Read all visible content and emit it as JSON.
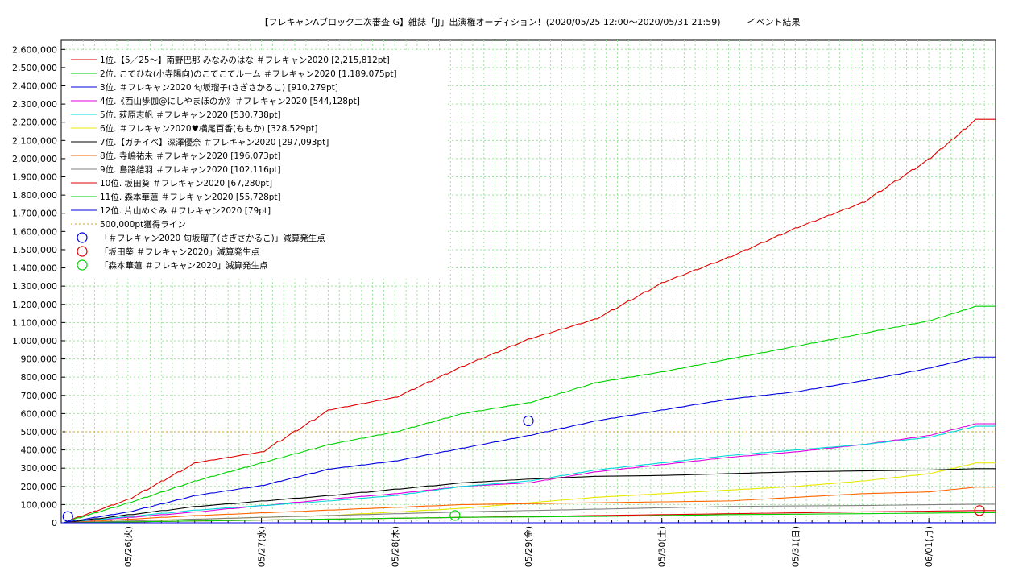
{
  "chart_data": {
    "type": "line",
    "title": "【フレキャンAブロック二次審査 G】雑誌「JJ」出演権オーディション！(2020/05/25 12:00〜2020/05/31 21:59)　　　イベント結果",
    "ylim": [
      0,
      2650000
    ],
    "y_ticks": [
      "0",
      "100,000",
      "200,000",
      "300,000",
      "400,000",
      "500,000",
      "600,000",
      "700,000",
      "800,000",
      "900,000",
      "1,000,000",
      "1,100,000",
      "1,200,000",
      "1,300,000",
      "1,400,000",
      "1,500,000",
      "1,600,000",
      "1,700,000",
      "1,800,000",
      "1,900,000",
      "2,000,000",
      "2,100,000",
      "2,200,000",
      "2,300,000",
      "2,400,000",
      "2,500,000",
      "2,600,000"
    ],
    "xlim": [
      "05/25 12:00",
      "06/01 12:00"
    ],
    "x_ticks": [
      "05/26(火)",
      "05/27(水)",
      "05/28(木)",
      "05/29(金)",
      "05/30(土)",
      "05/31(日)",
      "06/01(月)"
    ],
    "grid": true,
    "legend_position": "top-left",
    "reference_line": {
      "label": "500,000pt獲得ライン",
      "value": 500000,
      "color": "#d4a017"
    },
    "series": [
      {
        "name": "1位.【5／25〜】南野巴那 みなみのはな ＃フレキャン2020 [2,215,812pt]",
        "color": "#e00000",
        "x": [
          0,
          0.5,
          1,
          1.5,
          2,
          2.5,
          3,
          3.5,
          4,
          4.5,
          5,
          5.5,
          6,
          6.5,
          6.85
        ],
        "y": [
          0,
          130000,
          330000,
          390000,
          620000,
          690000,
          860000,
          1010000,
          1120000,
          1320000,
          1460000,
          1620000,
          1760000,
          2000000,
          2215812
        ]
      },
      {
        "name": "2位. こてひな(小寺陽向)のこてこてルーム ＃フレキャン2020 [1,189,075pt]",
        "color": "#00d000",
        "x": [
          0,
          0.5,
          1,
          1.5,
          2,
          2.5,
          3,
          3.5,
          4,
          4.5,
          5,
          5.5,
          6,
          6.5,
          6.85
        ],
        "y": [
          0,
          110000,
          230000,
          330000,
          430000,
          500000,
          600000,
          660000,
          770000,
          830000,
          900000,
          970000,
          1040000,
          1110000,
          1189075
        ]
      },
      {
        "name": "3位. ＃フレキャン2020 匂坂瑠子(さぎさかるこ) [910,279pt]",
        "color": "#0000e0",
        "x": [
          0,
          0.5,
          1,
          1.5,
          2,
          2.5,
          3,
          3.5,
          4,
          4.5,
          5,
          5.5,
          6,
          6.5,
          6.85
        ],
        "y": [
          0,
          60000,
          150000,
          205000,
          295000,
          340000,
          410000,
          480000,
          560000,
          620000,
          680000,
          720000,
          780000,
          850000,
          910279
        ]
      },
      {
        "name": "4位.《西山歩伽@にしやまほのか》＃フレキャン2020 [544,128pt]",
        "color": "#e000e0",
        "x": [
          0,
          1,
          2,
          2.5,
          3,
          3.5,
          4,
          4.5,
          5,
          5.5,
          6,
          6.5,
          6.85
        ],
        "y": [
          0,
          60000,
          130000,
          160000,
          200000,
          220000,
          280000,
          320000,
          360000,
          390000,
          430000,
          480000,
          544128
        ]
      },
      {
        "name": "5位. 荻原志帆 ＃フレキャン2020 [530,738pt]",
        "color": "#00d8d8",
        "x": [
          0,
          1,
          2,
          2.5,
          3,
          3.5,
          4,
          4.5,
          5,
          5.5,
          6,
          6.5,
          6.85
        ],
        "y": [
          0,
          70000,
          120000,
          150000,
          200000,
          230000,
          290000,
          330000,
          370000,
          400000,
          430000,
          470000,
          530738
        ]
      },
      {
        "name": "6位. ＃フレキャン2020♥横尾百香(ももか) [328,529pt]",
        "color": "#e8e800",
        "x": [
          0,
          1,
          2,
          3,
          3.5,
          4,
          4.5,
          5,
          5.5,
          6,
          6.5,
          6.85
        ],
        "y": [
          0,
          20000,
          40000,
          80000,
          110000,
          140000,
          160000,
          180000,
          200000,
          230000,
          270000,
          328529
        ]
      },
      {
        "name": "7位.【ガチイベ】深澤優奈 ＃フレキャン2020 [297,093pt]",
        "color": "#000000",
        "x": [
          0,
          1,
          2,
          3,
          3.5,
          4,
          4.5,
          5,
          5.5,
          6,
          6.5,
          6.85
        ],
        "y": [
          0,
          90000,
          150000,
          220000,
          240000,
          255000,
          260000,
          270000,
          280000,
          285000,
          290000,
          297093
        ]
      },
      {
        "name": "8位. 寺嶋祐未 ＃フレキャン2020 [196,073pt]",
        "color": "#ff6600",
        "x": [
          0,
          1,
          2,
          3,
          4,
          5,
          5.5,
          6,
          6.5,
          6.85
        ],
        "y": [
          0,
          40000,
          70000,
          100000,
          110000,
          120000,
          140000,
          160000,
          170000,
          196073
        ]
      },
      {
        "name": "9位. 島路結羽 ＃フレキャン2020 [102,116pt]",
        "color": "#808080",
        "x": [
          0,
          1,
          2,
          3,
          4,
          5,
          6,
          6.85
        ],
        "y": [
          0,
          20000,
          40000,
          60000,
          75000,
          90000,
          95000,
          102116
        ]
      },
      {
        "name": "10位. 坂田葵 ＃フレキャン2020 [67,280pt]",
        "color": "#e00000",
        "x": [
          0,
          1,
          2,
          3,
          4,
          5,
          6,
          6.85
        ],
        "y": [
          0,
          10000,
          20000,
          30000,
          40000,
          50000,
          60000,
          67280
        ]
      },
      {
        "name": "11位. 森本華蓮 ＃フレキャン2020 [55,728pt]",
        "color": "#00d000",
        "x": [
          0,
          1,
          2,
          3,
          4,
          5,
          6,
          6.85
        ],
        "y": [
          0,
          10000,
          20000,
          30000,
          35000,
          45000,
          50000,
          55728
        ]
      },
      {
        "name": "12位. 片山めぐみ ＃フレキャン2020 [79pt]",
        "color": "#0000e0",
        "x": [
          0,
          6.85
        ],
        "y": [
          0,
          79
        ]
      }
    ],
    "markers": [
      {
        "name": "「＃フレキャン2020 匂坂瑠子(さぎさかるこ)」減算発生点",
        "color": "#0000e0",
        "points": [
          [
            0.05,
            35000
          ],
          [
            3.5,
            560000
          ]
        ]
      },
      {
        "name": "「坂田葵 ＃フレキャン2020」減算発生点",
        "color": "#e00000",
        "points": [
          [
            6.88,
            67280
          ]
        ]
      },
      {
        "name": "「森本華蓮 ＃フレキャン2020」減算発生点",
        "color": "#00d000",
        "points": [
          [
            2.95,
            40000
          ]
        ]
      }
    ]
  }
}
